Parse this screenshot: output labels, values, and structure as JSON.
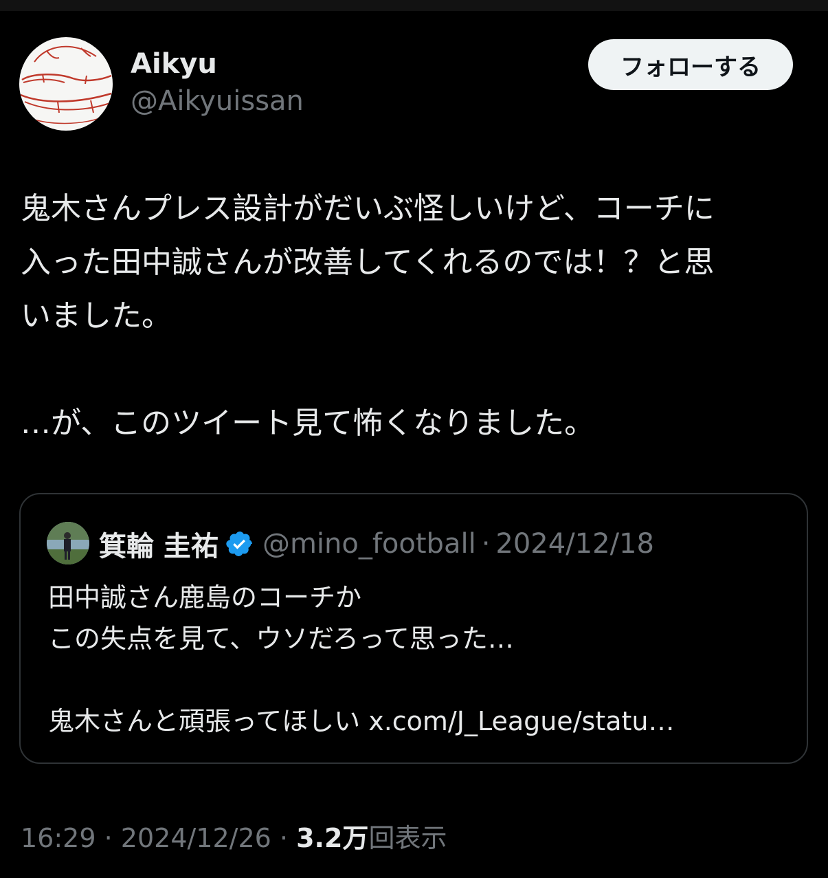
{
  "author": {
    "name": "Aikyu",
    "handle": "@Aikyuissan"
  },
  "follow_button": {
    "label": "フォローする"
  },
  "tweet": {
    "lines": [
      "鬼木さんプレス設計がだいぶ怪しいけど、コーチに",
      "入った田中誠さんが改善してくれるのでは！？と思",
      "いました。",
      "",
      "…が、このツイート見て怖くなりました。"
    ]
  },
  "quote": {
    "name": "箕輪 圭祐",
    "handle": "@mino_football",
    "separator": "·",
    "date": "2024/12/18",
    "lines": [
      "田中誠さん鹿島のコーチか",
      "この失点を見て、ウソだろって思った…",
      "",
      "鬼木さんと頑張ってほしい"
    ],
    "link": "x.com/J_League/statu…",
    "verified_color": "#1d9bf0"
  },
  "meta": {
    "time": "16:29",
    "separator": "·",
    "date": "2024/12/26",
    "views_count": "3.2万",
    "views_label": "回表示"
  },
  "icons": {
    "author_avatar": "hand-drawn-face-avatar",
    "quote_avatar": "photo-avatar",
    "verified": "verified-badge-icon"
  },
  "colors": {
    "background": "#000000",
    "text_primary": "#e7e9ea",
    "text_secondary": "#71767b",
    "border": "#2f3336",
    "button_bg": "#eff3f4"
  }
}
